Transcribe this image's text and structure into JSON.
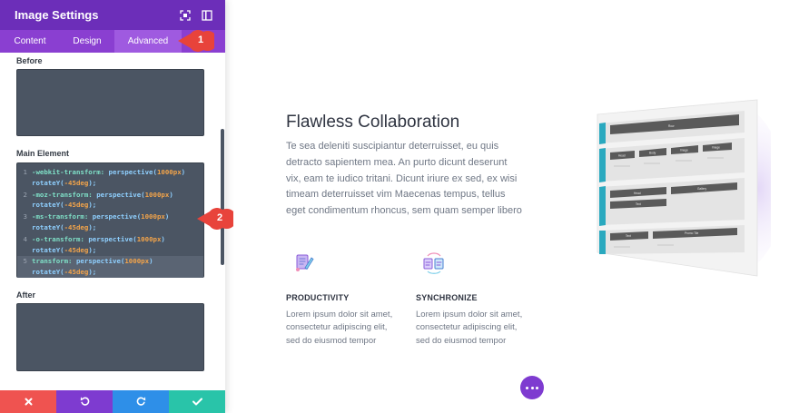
{
  "panel": {
    "title": "Image Settings",
    "tabs": [
      {
        "label": "Content",
        "active": false
      },
      {
        "label": "Design",
        "active": false
      },
      {
        "label": "Advanced",
        "active": true
      }
    ],
    "fields": {
      "before_label": "Before",
      "main_label": "Main Element",
      "after_label": "After"
    },
    "code_lines": [
      {
        "num": "1",
        "prop": "-webkit-transform:",
        "fn1": "perspective(",
        "n1": "1000px",
        "mid": ") ",
        "fn2": "rotateY(",
        "n2": "-45deg",
        "end": ");"
      },
      {
        "num": "2",
        "prop": "-moz-transform:",
        "fn1": "perspective(",
        "n1": "1000px",
        "mid": ") ",
        "fn2": "rotateY(",
        "n2": "-45deg",
        "end": ");"
      },
      {
        "num": "3",
        "prop": "-ms-transform:",
        "fn1": "perspective(",
        "n1": "1000px",
        "mid": ") ",
        "fn2": "rotateY(",
        "n2": "-45deg",
        "end": ");"
      },
      {
        "num": "4",
        "prop": "-o-transform:",
        "fn1": "perspective(",
        "n1": "1000px",
        "mid": ") ",
        "fn2": "rotateY(",
        "n2": "-45deg",
        "end": ");"
      },
      {
        "num": "5",
        "prop": "transform:",
        "fn1": "perspective(",
        "n1": "1000px",
        "mid": ") ",
        "fn2": "rotateY(",
        "n2": "-45deg",
        "end": ");"
      }
    ],
    "actions": [
      {
        "name": "discard",
        "icon": "close-icon",
        "color": "#ef5350"
      },
      {
        "name": "undo",
        "icon": "undo-icon",
        "color": "#7e3bd0"
      },
      {
        "name": "redo",
        "icon": "redo-icon",
        "color": "#2e8fe8"
      },
      {
        "name": "save",
        "icon": "check-icon",
        "color": "#29c4a9"
      }
    ]
  },
  "callouts": [
    "1",
    "2"
  ],
  "preview": {
    "heading": "Flawless Collaboration",
    "body": "Te sea deleniti suscipiantur deterruisset, eu quis detracto sapientem mea. An purto dicunt deserunt vix, eam te iudico tritani. Dicunt iriure ex sed, ex wisi timeam deterruisset vim Maecenas tempus, tellus eget condimentum rhoncus, sem quam semper libero",
    "features": [
      {
        "title": "PRODUCTIVITY",
        "desc": "Lorem ipsum dolor sit amet, consectetur adipiscing elit, sed do eiusmod tempor",
        "icon": "productivity-icon"
      },
      {
        "title": "SYNCHRONIZE",
        "desc": "Lorem ipsum dolor sit amet, consectetur adipiscing elit, sed do eiusmod tempor",
        "icon": "synchronize-icon"
      }
    ]
  },
  "mockup": {
    "labels": [
      "Row",
      "Head",
      "Body",
      "Image",
      "Image",
      "Head",
      "Gallery",
      "Text",
      "Text",
      "Promo Tile"
    ]
  },
  "colors": {
    "header": "#6c2eb9",
    "tabs": "#8a3fd1",
    "callout": "#e8433b",
    "accent": "#7e3bd0"
  }
}
